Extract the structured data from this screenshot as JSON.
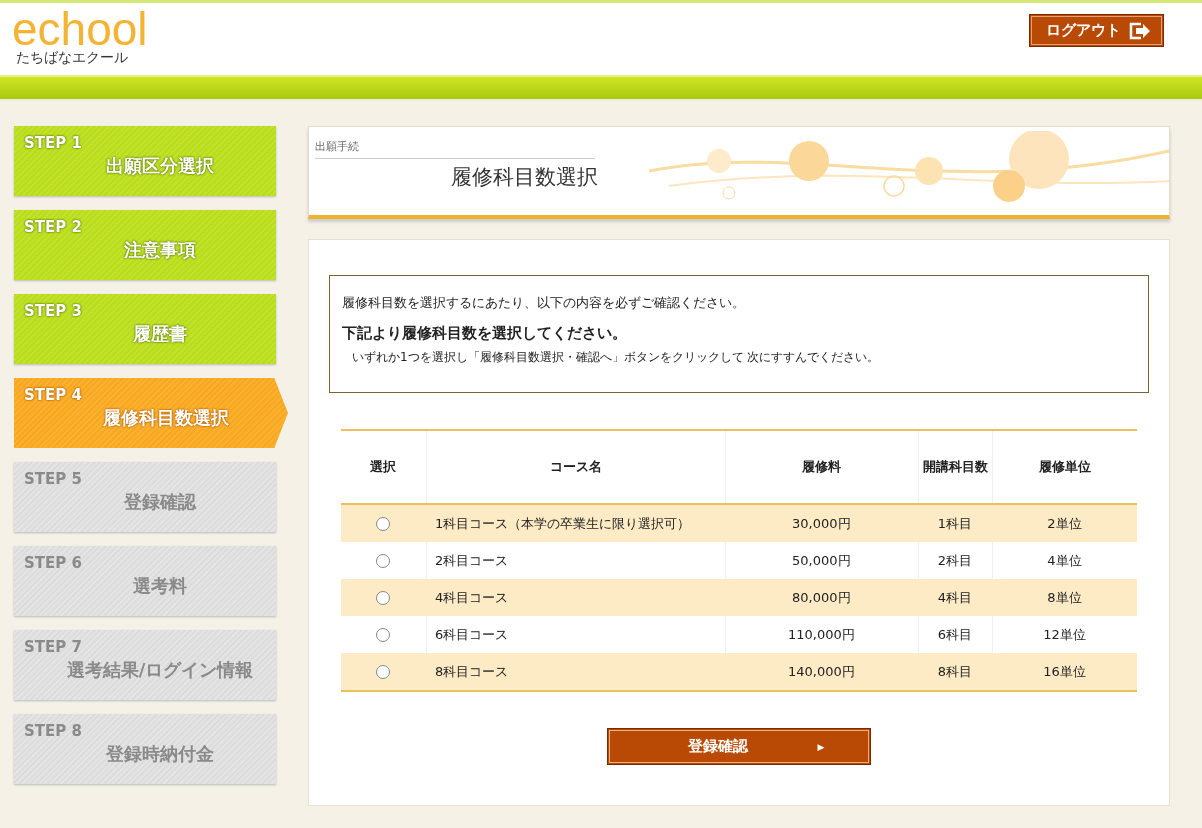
{
  "header": {
    "logo": "echool",
    "logo_sub": "たちばなエクール",
    "logout": "ログアウト"
  },
  "steps": [
    {
      "step": "STEP 1",
      "label": "出願区分選択",
      "selected": false,
      "disabled": false
    },
    {
      "step": "STEP 2",
      "label": "注意事項",
      "selected": false,
      "disabled": false
    },
    {
      "step": "STEP 3",
      "label": "履歴書",
      "selected": false,
      "disabled": false
    },
    {
      "step": "STEP 4",
      "label": "履修科目数選択",
      "selected": true,
      "disabled": false
    },
    {
      "step": "STEP 5",
      "label": "登録確認",
      "selected": false,
      "disabled": true
    },
    {
      "step": "STEP 6",
      "label": "選考料",
      "selected": false,
      "disabled": true
    },
    {
      "step": "STEP 7",
      "label": "選考結果/ログイン情報",
      "selected": false,
      "disabled": true
    },
    {
      "step": "STEP 8",
      "label": "登録時納付金",
      "selected": false,
      "disabled": true
    }
  ],
  "page_banner": {
    "category": "出願手続",
    "title": "履修科目数選択"
  },
  "notice": {
    "intro": "履修科目数を選択するにあたり、以下の内容を必ずご確認ください。",
    "heading": "下記より履修科目数を選択してください。",
    "body": "いずれか1つを選択し「履修科目数選択・確認へ」ボタンをクリックして 次にすすんでください。"
  },
  "table": {
    "columns": [
      "選択",
      "コース名",
      "履修料",
      "開講科目数",
      "履修単位"
    ],
    "rows": [
      {
        "selected": false,
        "course": "1科目コース（本学の卒業生に限り選択可）",
        "fee": "30,000円",
        "subjects": "1科目",
        "credits": "2単位"
      },
      {
        "selected": false,
        "course": "2科目コース",
        "fee": "50,000円",
        "subjects": "2科目",
        "credits": "4単位"
      },
      {
        "selected": false,
        "course": "4科目コース",
        "fee": "80,000円",
        "subjects": "4科目",
        "credits": "8単位"
      },
      {
        "selected": false,
        "course": "6科目コース",
        "fee": "110,000円",
        "subjects": "6科目",
        "credits": "12単位"
      },
      {
        "selected": false,
        "course": "8科目コース",
        "fee": "140,000円",
        "subjects": "8科目",
        "credits": "16単位"
      }
    ]
  },
  "submit": {
    "label": "登録確認",
    "arrow": "▶"
  }
}
